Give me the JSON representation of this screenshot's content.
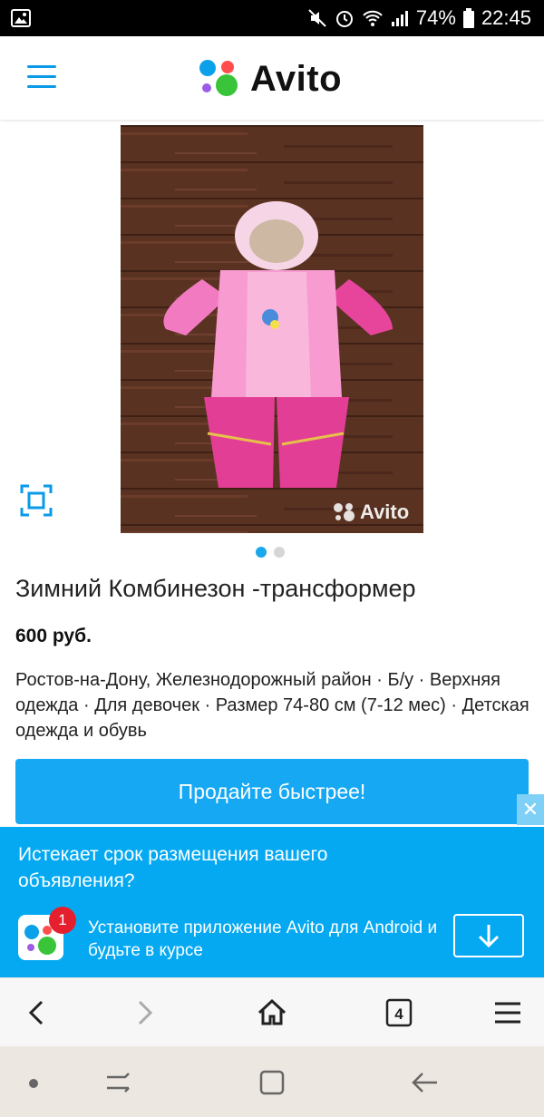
{
  "status_bar": {
    "battery": "74%",
    "time": "22:45"
  },
  "header": {
    "logo_text": "Avito",
    "logo_colors": [
      "#0aa1ea",
      "#ff4d4d",
      "#9b5de5",
      "#3ac43a"
    ]
  },
  "listing": {
    "photo_watermark": "Avito",
    "photo_count": 2,
    "active_photo": 1,
    "title": "Зимний Комбинезон -трансформер",
    "price": "600 руб.",
    "meta": "Ростов-на-Дону, Железнодорожный район · Б/у · Верхняя одежда · Для девочек · Размер 74-80 см (7-12 мес) · Детская одежда и обувь"
  },
  "sell_button": {
    "label": "Продайте быстрее!"
  },
  "banner": {
    "question": "Истекает срок размещения вашего объявления?",
    "badge_count": "1",
    "install_text": "Установите приложение Avito для Android и будьте в курсе"
  },
  "browser_bar": {
    "tabs_count": "4"
  },
  "colors": {
    "accent": "#16a8f3",
    "banner": "#04a9f2"
  }
}
